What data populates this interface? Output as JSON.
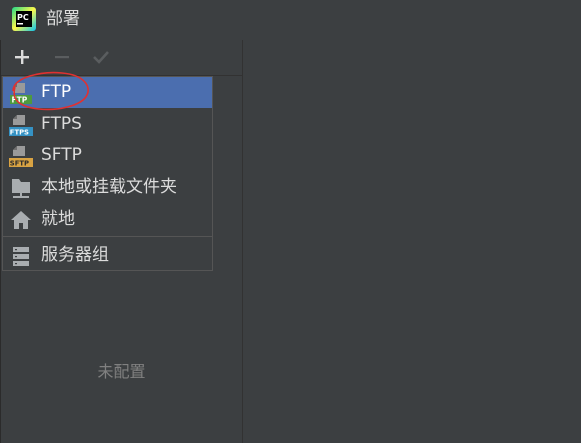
{
  "window": {
    "title": "部署",
    "app_icon_text": "PC"
  },
  "toolbar": {
    "add_label": "+",
    "remove_label": "−",
    "apply_label": "✓"
  },
  "popup": {
    "items": [
      {
        "label": "FTP",
        "icon": "ftp-icon",
        "badge": "FTP",
        "badge_color": "#4e9a3e",
        "selected": true
      },
      {
        "label": "FTPS",
        "icon": "ftps-icon",
        "badge": "FTPS",
        "badge_color": "#3592c4"
      },
      {
        "label": "SFTP",
        "icon": "sftp-icon",
        "badge": "SFTP",
        "badge_color": "#d9a343"
      },
      {
        "label": "本地或挂载文件夹",
        "icon": "folder-icon"
      },
      {
        "label": "就地",
        "icon": "home-icon"
      },
      {
        "label": "服务器组",
        "icon": "server-group-icon"
      }
    ]
  },
  "empty_state": {
    "text": "未配置"
  },
  "colors": {
    "background": "#3c3f41",
    "selection": "#4b6eaf",
    "annotation": "#e03131"
  }
}
